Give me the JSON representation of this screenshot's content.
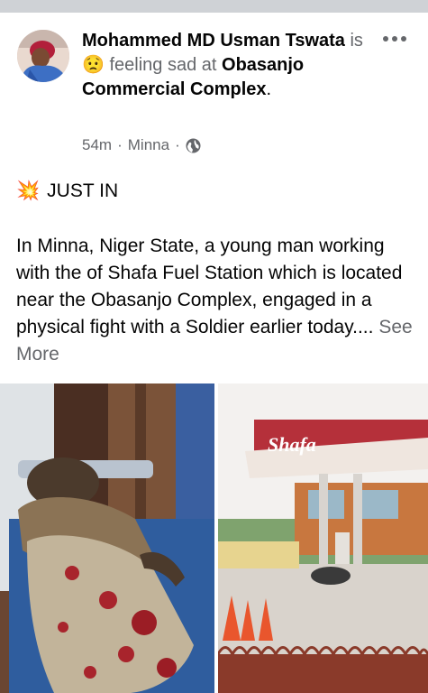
{
  "post": {
    "author": "Mohammed MD Usman Tswata",
    "is_text": "is",
    "feeling_emoji": "😟",
    "feeling_text": "feeling sad at",
    "place": "Obasanjo Commercial Complex",
    "period": ".",
    "time": "54m",
    "separator": "·",
    "location": "Minna",
    "privacy_icon": "globe-icon",
    "more_icon": "more-options-icon"
  },
  "content": {
    "headline_emoji": "💥",
    "headline": "JUST IN",
    "body": "In Minna, Niger State, a young man working with the of Shafa Fuel Station which is located near the Obasanjo Complex, engaged in a physical fight with a Soldier earlier today....",
    "see_more": "See More"
  },
  "photos": [
    {
      "description_icon": "injured-man-photo"
    },
    {
      "description_icon": "fuel-station-photo",
      "sign_text": "Shafa"
    }
  ],
  "colors": {
    "text": "#050505",
    "muted": "#65676b",
    "top_bar": "#cfd2d6",
    "station_red": "#b5303a"
  }
}
